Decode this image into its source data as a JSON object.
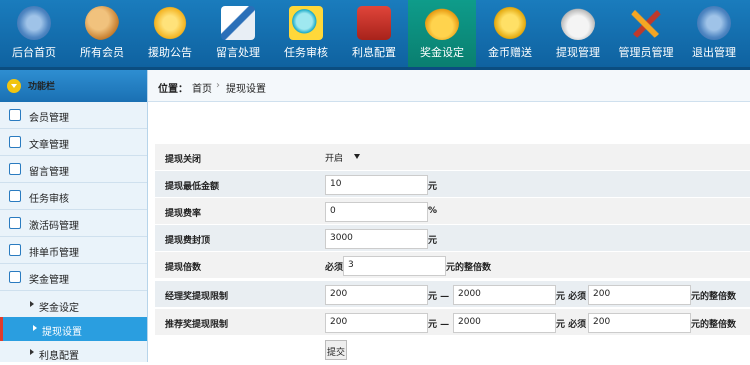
{
  "nav": {
    "items": [
      {
        "label": "后台首页",
        "icon": "gear-icon"
      },
      {
        "label": "所有会员",
        "icon": "users-icon"
      },
      {
        "label": "援助公告",
        "icon": "megaphone-icon"
      },
      {
        "label": "留言处理",
        "icon": "pen-icon"
      },
      {
        "label": "任务审核",
        "icon": "magnifier-icon"
      },
      {
        "label": "利息配置",
        "icon": "wallet-icon"
      },
      {
        "label": "奖金设定",
        "icon": "money-bag-icon"
      },
      {
        "label": "金币赠送",
        "icon": "coins-icon"
      },
      {
        "label": "提现管理",
        "icon": "dollar-bag-icon"
      },
      {
        "label": "管理员管理",
        "icon": "tools-icon"
      },
      {
        "label": "退出管理",
        "icon": "gear-icon"
      }
    ],
    "active_index": 6
  },
  "sidebar": {
    "title": "功能栏",
    "items": [
      {
        "label": "会员管理"
      },
      {
        "label": "文章管理"
      },
      {
        "label": "留言管理"
      },
      {
        "label": "任务审核"
      },
      {
        "label": "激活码管理"
      },
      {
        "label": "排单币管理"
      },
      {
        "label": "奖金管理"
      }
    ],
    "subitems": [
      {
        "label": "奖金设定",
        "active": false
      },
      {
        "label": "提现设置",
        "active": true
      },
      {
        "label": "利息配置",
        "active": false
      }
    ]
  },
  "breadcrumb": {
    "prefix": "位置：",
    "home": "首页",
    "sep": "›",
    "current": "提现设置"
  },
  "form": {
    "close_label": "提现关闭",
    "close_value": "开启",
    "min_label": "提现最低金额",
    "min_value": "10",
    "min_unit": "元",
    "fee_label": "提现费率",
    "fee_value": "0",
    "fee_unit": "%",
    "cap_label": "提现费封顶",
    "cap_value": "3000",
    "cap_unit": "元",
    "multiple_label": "提现倍数",
    "multiple_prefix": "必须",
    "multiple_value": "3",
    "multiple_suffix": "元的整倍数",
    "manager_label": "经理奖提现限制",
    "manager_min": "200",
    "manager_dash": "元 —",
    "manager_max": "2000",
    "manager_mid": "元 必须",
    "manager_multiple": "200",
    "manager_suffix": "元的整倍数",
    "referral_label": "推荐奖提现限制",
    "referral_min": "200",
    "referral_dash": "元 —",
    "referral_max": "2000",
    "referral_mid": "元 必须",
    "referral_multiple": "200",
    "referral_suffix": "元的整倍数",
    "submit_label": "提交"
  },
  "colors": {
    "nav_bg": "#1a7cbd",
    "nav_active": "#0e9c8a",
    "sidebar_head": "#2e8ed1",
    "sub_active": "#2a9ee0",
    "sub_active_marker": "#e03c2c"
  }
}
